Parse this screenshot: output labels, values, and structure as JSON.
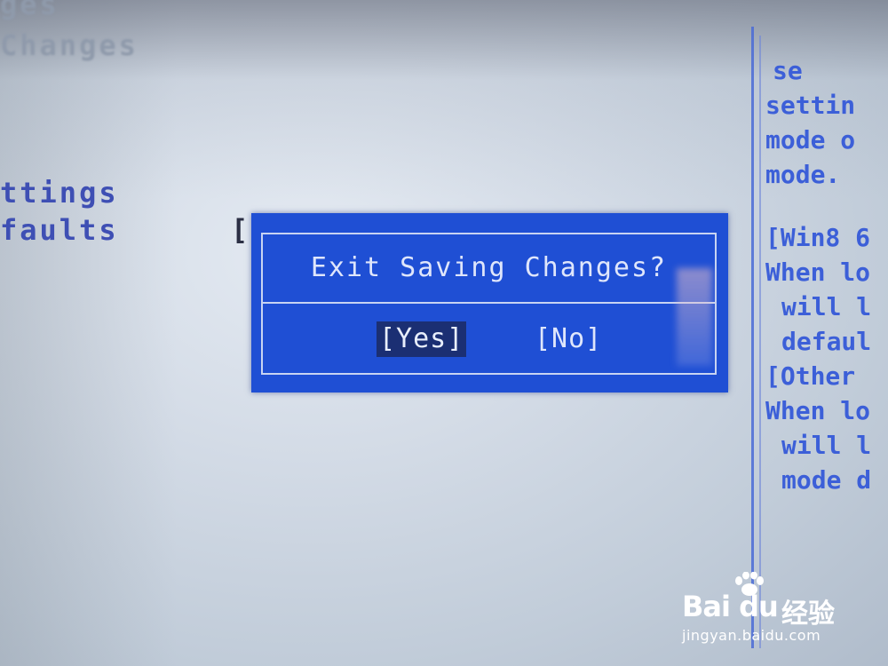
{
  "left_panel": {
    "line1": "ges",
    "line2": "Changes",
    "line3": "ttings",
    "line4": "faults",
    "bracket": "["
  },
  "help_panel": {
    "lines": [
      "se",
      "settin",
      "mode o",
      "mode.",
      "",
      "[Win8 6",
      "When lo",
      "will l",
      "defaul",
      "[Other",
      "When lo",
      "will l",
      "mode d"
    ]
  },
  "dialog": {
    "title": "Exit Saving Changes?",
    "yes_label": "[Yes]",
    "no_label": "[No]",
    "selected": "yes"
  },
  "watermark": {
    "logo_text": "Bai du",
    "cn_text": "经验",
    "url": "jingyan.baidu.com"
  },
  "colors": {
    "dialog_bg": "#1f4fd4",
    "selected_bg": "#1b2f73",
    "help_text": "#3c5fd8"
  }
}
